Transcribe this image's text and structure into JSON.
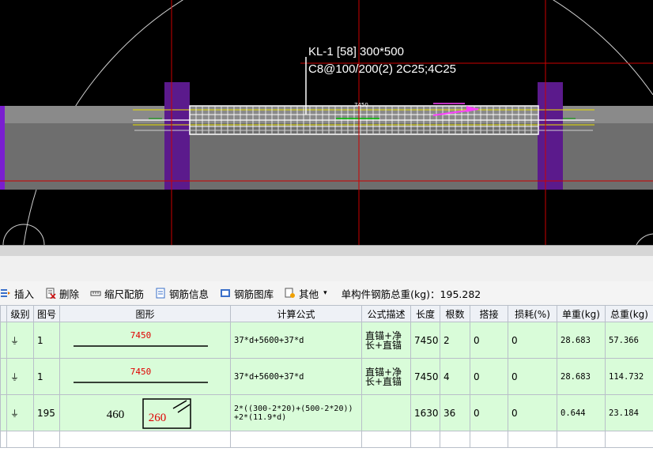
{
  "beam_label": {
    "line1": "KL-1 [58] 300*500",
    "line2": "C8@100/200(2) 2C25;4C25"
  },
  "cad": {
    "dim_text": "7450"
  },
  "toolbar": {
    "insert": "插入",
    "delete": "删除",
    "scale": "缩尺配筋",
    "info": "钢筋信息",
    "library": "钢筋图库",
    "other": "其他",
    "total": "单构件钢筋总重(kg)：195.282"
  },
  "table": {
    "headers": [
      "级别",
      "图号",
      "图形",
      "计算公式",
      "公式描述",
      "长度",
      "根数",
      "搭接",
      "损耗(%)",
      "单重(kg)",
      "总重(kg)"
    ],
    "rows": [
      {
        "grade": "⏚",
        "fig_no": "1",
        "shape_text": "7450",
        "formula": "37*d+5600+37*d",
        "desc": "直锚+净长+直锚",
        "length": "7450",
        "count": "2",
        "lap": "0",
        "loss": "0",
        "unit_wt": "28.683",
        "total_wt": "57.366"
      },
      {
        "grade": "⏚",
        "fig_no": "1",
        "shape_text": "7450",
        "formula": "37*d+5600+37*d",
        "desc": "直锚+净长+直锚",
        "length": "7450",
        "count": "4",
        "lap": "0",
        "loss": "0",
        "unit_wt": "28.683",
        "total_wt": "114.732"
      },
      {
        "grade": "⏚",
        "fig_no": "195",
        "shape_a": "460",
        "shape_b": "260",
        "formula_l1": "2*((300-2*20)+(500-2*20))",
        "formula_l2": "+2*(11.9*d)",
        "desc": "",
        "length": "1630",
        "count": "36",
        "lap": "0",
        "loss": "0",
        "unit_wt": "0.644",
        "total_wt": "23.184"
      }
    ]
  },
  "colors": {
    "canvas_bg": "#000000",
    "grid_line": "#cc0000",
    "column": "#5b1a8c",
    "rebar_green": "#00c000",
    "arrow_magenta": "#ff40ff",
    "row_bg": "#d9fcd9",
    "dim_red": "#e00000"
  }
}
